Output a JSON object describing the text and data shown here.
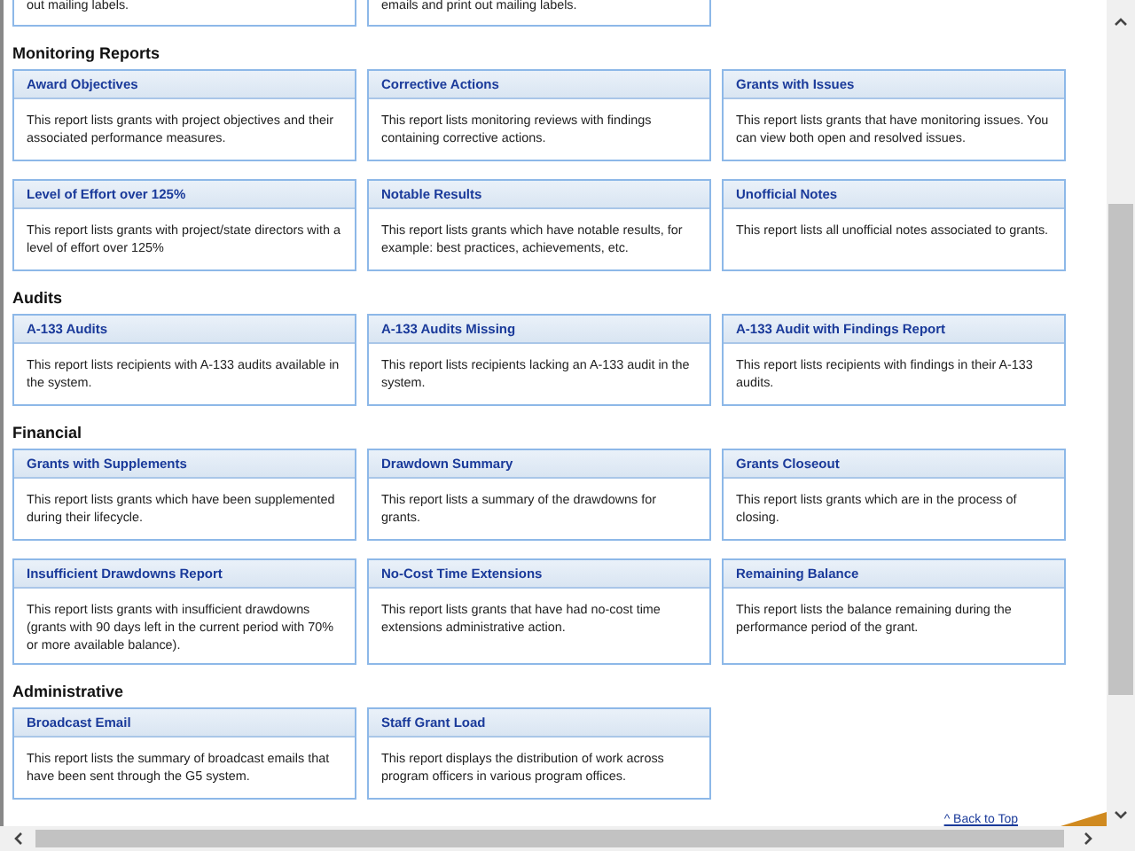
{
  "partial_cards": [
    {
      "description": "out mailing labels."
    },
    {
      "description": "emails and print out mailing labels."
    }
  ],
  "sections": [
    {
      "title": "Monitoring Reports",
      "cards": [
        {
          "title": "Award Objectives",
          "description": "This report lists grants with project objectives and their associated performance measures."
        },
        {
          "title": "Corrective Actions",
          "description": "This report lists monitoring reviews with findings containing corrective actions."
        },
        {
          "title": "Grants with Issues",
          "description": "This report lists grants that have monitoring issues. You can view both open and resolved issues."
        },
        {
          "title": "Level of Effort over 125%",
          "description": "This report lists grants with project/state directors with a level of effort over 125%"
        },
        {
          "title": "Notable Results",
          "description": "This report lists grants which have notable results, for example: best practices, achievements, etc."
        },
        {
          "title": "Unofficial Notes",
          "description": "This report lists all unofficial notes associated to grants."
        }
      ]
    },
    {
      "title": "Audits",
      "cards": [
        {
          "title": "A-133 Audits",
          "description": "This report lists recipients with A-133 audits available in the system."
        },
        {
          "title": "A-133 Audits Missing",
          "description": "This report lists recipients lacking an A-133 audit in the system."
        },
        {
          "title": "A-133 Audit with Findings Report",
          "description": "This report lists recipients with findings in their A-133 audits."
        }
      ]
    },
    {
      "title": "Financial",
      "cards": [
        {
          "title": "Grants with Supplements",
          "description": "This report lists grants which have been supplemented during their lifecycle."
        },
        {
          "title": "Drawdown Summary",
          "description": "This report lists a summary of the drawdowns for grants."
        },
        {
          "title": "Grants Closeout",
          "description": "This report lists grants which are in the process of closing."
        },
        {
          "title": "Insufficient Drawdowns Report",
          "description": "This report lists grants with insufficient drawdowns (grants with 90 days left in the current period with 70% or more available balance)."
        },
        {
          "title": "No-Cost Time Extensions",
          "description": "This report lists grants that have had no-cost time extensions administrative action."
        },
        {
          "title": "Remaining Balance",
          "description": "This report lists the balance remaining during the performance period of the grant."
        }
      ]
    },
    {
      "title": "Administrative",
      "cards": [
        {
          "title": "Broadcast Email",
          "description": "This report lists the summary of broadcast emails that have been sent through the G5 system."
        },
        {
          "title": "Staff Grant Load",
          "description": "This report displays the distribution of work across program officers in various program offices."
        }
      ]
    }
  ],
  "back_to_top": "^ Back to Top"
}
